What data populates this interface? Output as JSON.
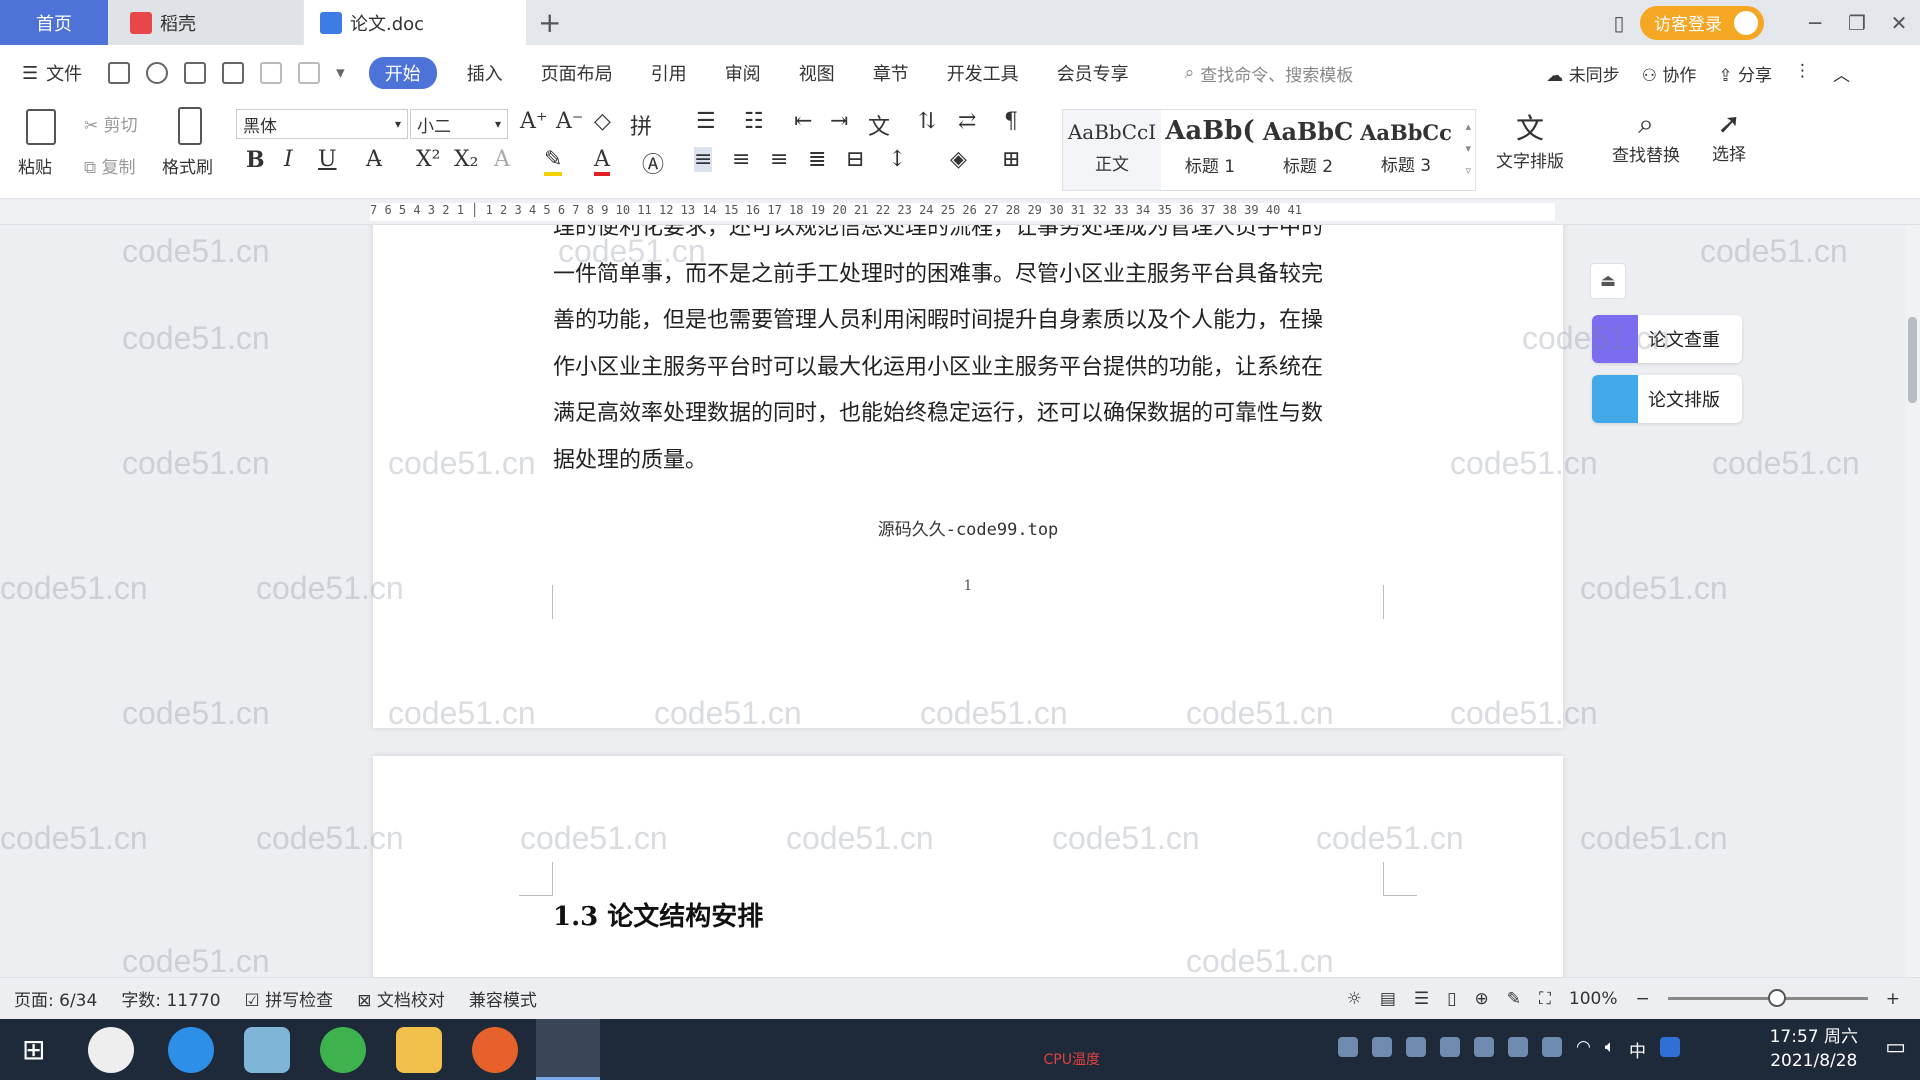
{
  "tabs": {
    "home": "首页",
    "docer": "稻壳",
    "doc": "论文.doc",
    "new_tab": "+"
  },
  "titlebar": {
    "login": "访客登录"
  },
  "menubar": {
    "file": "文件",
    "items": [
      "开始",
      "插入",
      "页面布局",
      "引用",
      "审阅",
      "视图",
      "章节",
      "开发工具",
      "会员专享"
    ],
    "search_placeholder": "查找命令、搜索模板",
    "sync": "未同步",
    "collab": "协作",
    "share": "分享"
  },
  "ribbon": {
    "paste": "粘贴",
    "cut": "剪切",
    "copy": "复制",
    "format_painter": "格式刷",
    "font_name": "黑体",
    "font_size": "小二",
    "styles": [
      {
        "preview": "AaBbCcI",
        "name": "正文"
      },
      {
        "preview": "AaBb(",
        "name": "标题 1"
      },
      {
        "preview": "AaBbC",
        "name": "标题 2"
      },
      {
        "preview": "AaBbCc",
        "name": "标题 3"
      }
    ],
    "text_layout": "文字排版",
    "find_replace": "查找替换",
    "select": "选择"
  },
  "ruler": {
    "scale": "7 6 5 4 3 2 1 │ 1 2 3 4 5 6 7 8 9 10 11 12 13 14 15 16 17 18 19 20 21 22 23 24 25 26 27 28 29 30 31 32 33 34 35 36 37 38 39 40 41"
  },
  "document": {
    "page1_lines": [
      "理的便利化要求，还可以规范信息处理的流程，让事务处理成为管理人员手中的",
      "一件简单事，而不是之前手工处理时的困难事。尽管小区业主服务平台具备较完",
      "善的功能，但是也需要管理人员利用闲暇时间提升自身素质以及个人能力，在操",
      "作小区业主服务平台时可以最大化运用小区业主服务平台提供的功能，让系统在",
      "满足高效率处理数据的同时，也能始终稳定运行，还可以确保数据的可靠性与数",
      "据处理的质量。"
    ],
    "footer": "源码久久-code99.top",
    "page_number": "1",
    "page2_heading": "1.3 论文结构安排"
  },
  "side_panel": {
    "check": "论文查重",
    "format": "论文排版"
  },
  "watermark": "code51.cn",
  "statusbar": {
    "page": "页面: 6/34",
    "words": "字数: 11770",
    "spell": "拼写检查",
    "proof": "文档校对",
    "compat": "兼容模式",
    "zoom": "100%"
  },
  "taskbar": {
    "time": "17:57 周六",
    "date": "2021/8/28",
    "ime": "中",
    "cpu": "CPU温度"
  }
}
